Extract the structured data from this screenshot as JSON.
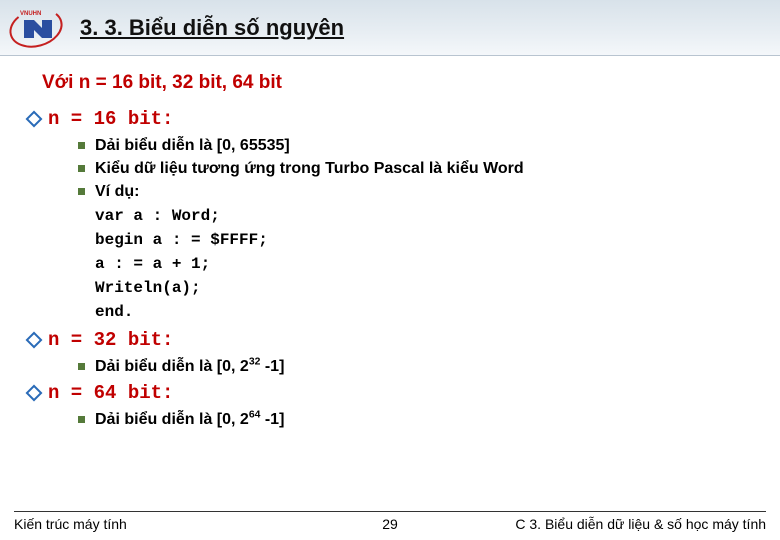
{
  "header": {
    "title": "3. 3. Biểu diễn số nguyên"
  },
  "subtitle": "Với n = 16 bit, 32 bit, 64 bit",
  "sections": [
    {
      "heading": "n = 16 bit:",
      "items": [
        {
          "text": "Dải biểu diễn là [0, 65535]"
        },
        {
          "text": "Kiểu dữ liệu tương ứng trong Turbo Pascal là kiểu Word"
        },
        {
          "text": "Ví dụ:",
          "code": [
            "var a : Word;",
            "begin a : = $FFFF;",
            "a : = a + 1;",
            "Writeln(a);",
            "end."
          ]
        }
      ]
    },
    {
      "heading": "n = 32 bit:",
      "items": [
        {
          "text_html": "Dải biểu diễn là [0, 2<sup>32</sup> -1]"
        }
      ]
    },
    {
      "heading": "n = 64 bit:",
      "items": [
        {
          "text_html": "Dải biểu diễn là [0, 2<sup>64</sup> -1]"
        }
      ]
    }
  ],
  "footer": {
    "left": "Kiến trúc máy tính",
    "page": "29",
    "right": "C 3. Biểu diễn dữ liệu & số học máy tính"
  }
}
